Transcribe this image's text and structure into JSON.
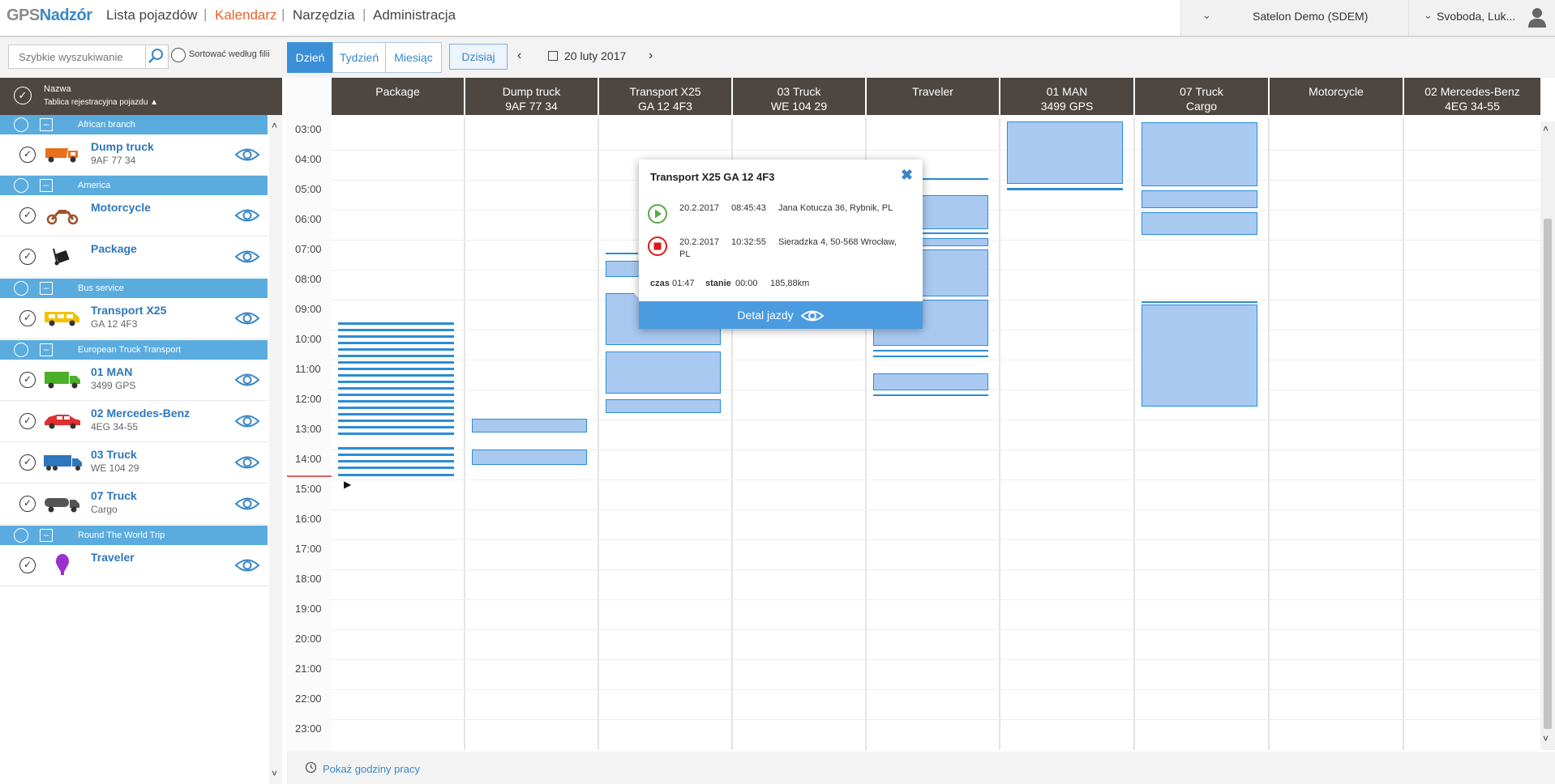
{
  "app": {
    "logo_a": "GPS",
    "logo_b": "Nadzór",
    "nav": [
      {
        "label": "Lista pojazdów",
        "active": false
      },
      {
        "label": "Kalendarz",
        "active": true
      },
      {
        "label": "Narzędzia",
        "active": false
      },
      {
        "label": "Administracja",
        "active": false
      }
    ],
    "company": "Satelon Demo (SDEM)",
    "user": "Svoboda, Luk..."
  },
  "toolbar": {
    "search_placeholder": "Szybkie wyszukiwanie",
    "sort_label": "Sortować według filii",
    "views": [
      "Dzień",
      "Tydzień",
      "Miesiąc"
    ],
    "active_view": "Dzień",
    "today": "Dzisiaj",
    "date": "20 luty 2017"
  },
  "left": {
    "header_name": "Nazwa",
    "header_plate": "Tablica rejestracyjna pojazdu ▲",
    "groups": [
      {
        "label": "African branch",
        "vehicles": [
          {
            "name": "Dump truck",
            "plate": "9AF 77 34",
            "icon": "dump-truck-icon",
            "color": "#e8701f"
          }
        ]
      },
      {
        "label": "America",
        "vehicles": [
          {
            "name": "Motorcycle",
            "plate": "",
            "icon": "motorcycle-icon",
            "color": "#a0522d"
          },
          {
            "name": "Package",
            "plate": "",
            "icon": "package-icon",
            "color": "#222222"
          }
        ]
      },
      {
        "label": "Bus service",
        "vehicles": [
          {
            "name": "Transport X25",
            "plate": "GA 12 4F3",
            "icon": "van-icon",
            "color": "#f2c200"
          }
        ]
      },
      {
        "label": "European Truck Transport",
        "vehicles": [
          {
            "name": "01 MAN",
            "plate": "3499 GPS",
            "icon": "truck-icon",
            "color": "#4caf2a"
          },
          {
            "name": "02 Mercedes-Benz",
            "plate": "4EG 34-55",
            "icon": "car-icon",
            "color": "#e03030"
          },
          {
            "name": "03 Truck",
            "plate": "WE 104 29",
            "icon": "semi-truck-icon",
            "color": "#2e77bb"
          },
          {
            "name": "07 Truck",
            "plate": "Cargo",
            "icon": "tanker-truck-icon",
            "color": "#555555"
          }
        ]
      },
      {
        "label": "Round The World Trip",
        "vehicles": [
          {
            "name": "Traveler",
            "plate": "",
            "icon": "balloon-icon",
            "color": "#9b30d0"
          }
        ]
      }
    ]
  },
  "calendar": {
    "hours": [
      "03:00",
      "04:00",
      "05:00",
      "06:00",
      "07:00",
      "08:00",
      "09:00",
      "10:00",
      "11:00",
      "12:00",
      "13:00",
      "14:00",
      "15:00",
      "16:00",
      "17:00",
      "18:00",
      "19:00",
      "20:00",
      "21:00",
      "22:00",
      "23:00"
    ],
    "columns": [
      {
        "line1": "Package",
        "line2": ""
      },
      {
        "line1": "Dump truck",
        "line2": "9AF 77 34"
      },
      {
        "line1": "Transport X25",
        "line2": "GA 12 4F3"
      },
      {
        "line1": "03 Truck",
        "line2": "WE 104 29"
      },
      {
        "line1": "Traveler",
        "line2": ""
      },
      {
        "line1": "01 MAN",
        "line2": "3499 GPS"
      },
      {
        "line1": "07 Truck",
        "line2": "Cargo"
      },
      {
        "line1": "Motorcycle",
        "line2": ""
      },
      {
        "line1": "02 Mercedes-Benz",
        "line2": "4EG 34-55"
      }
    ],
    "footer_link": "Pokaż godziny pracy"
  },
  "popup": {
    "title": "Transport X25 GA 12 4F3",
    "start": {
      "date": "20.2.2017",
      "time": "08:45:43",
      "address": "Jana Kotucza 36, Rybnik, PL"
    },
    "end": {
      "date": "20.2.2017",
      "time": "10:32:55",
      "address": "Sieradzka 4, 50-568 Wrocław,",
      "address2": "PL"
    },
    "czas_label": "czas",
    "czas_value": "01:47",
    "stanie_label": "stanie",
    "stanie_value": "00:00",
    "distance": "185,88km",
    "button": "Detal jazdy"
  },
  "colors": {
    "accent": "#3a87c8",
    "header_bg": "#4d4641",
    "group_bg": "#5aacdf",
    "active_nav": "#e8612c",
    "event_fill": "#a9c9f1",
    "event_border": "#2b8dd6"
  }
}
